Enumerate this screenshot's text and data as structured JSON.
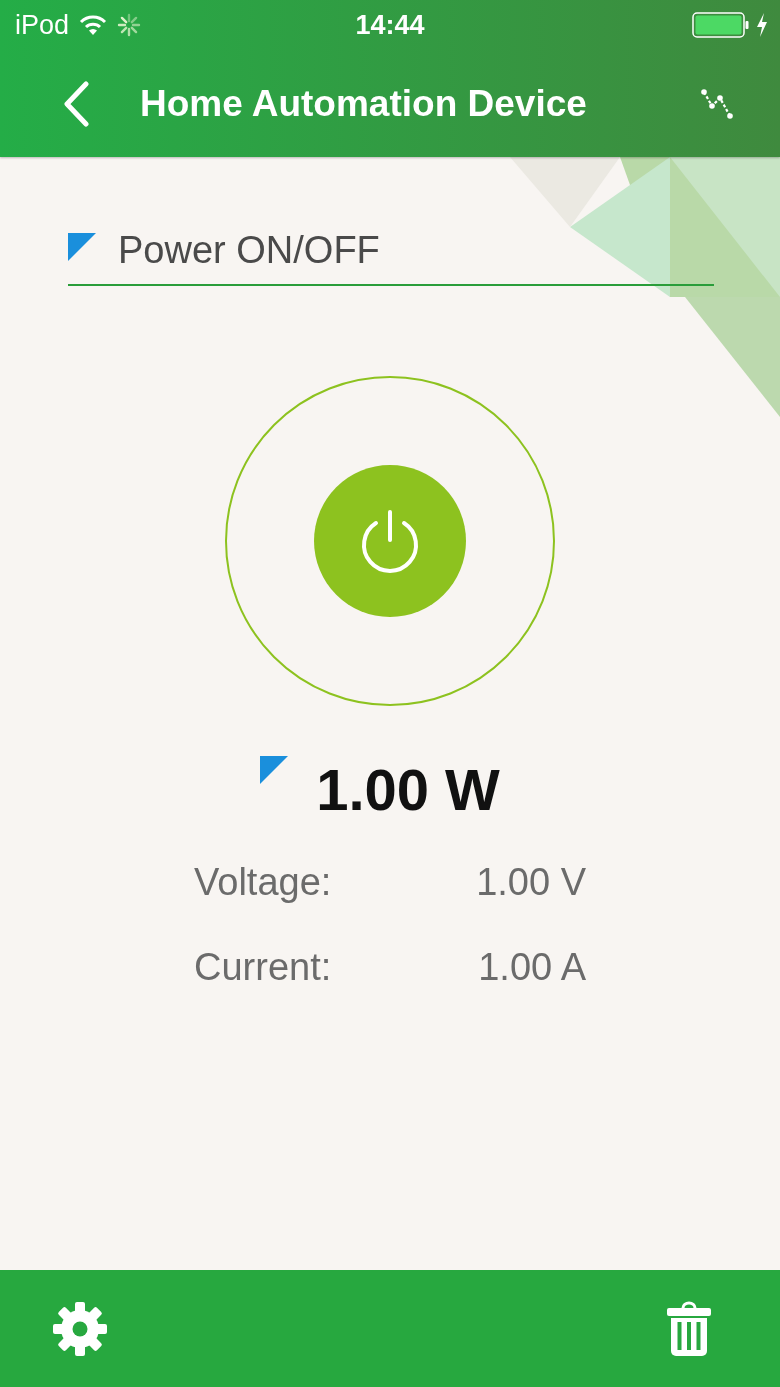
{
  "status_bar": {
    "carrier": "iPod",
    "time": "14:44"
  },
  "nav_bar": {
    "title": "Home Automation Device"
  },
  "power": {
    "label": "Power ON/OFF",
    "on": true
  },
  "reading": "1.00 W",
  "measurements": [
    {
      "label": "Voltage:",
      "value": "1.00 V"
    },
    {
      "label": "Current:",
      "value": "1.00 A"
    }
  ]
}
